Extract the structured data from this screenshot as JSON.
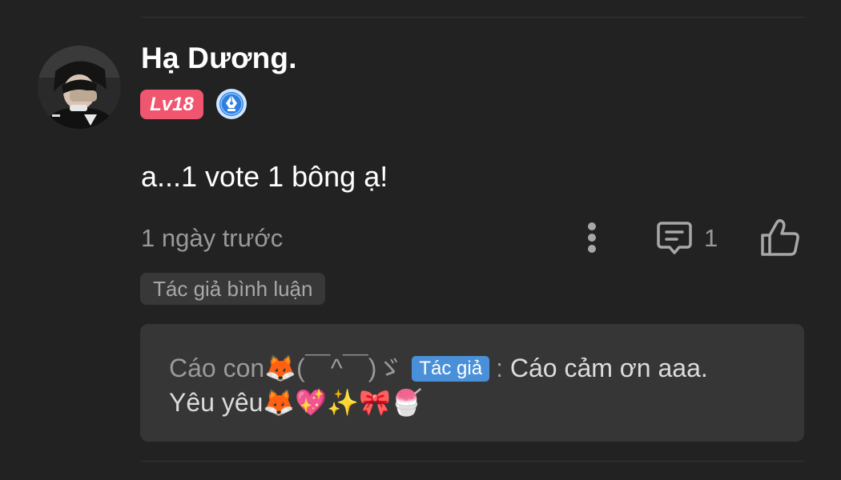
{
  "comment": {
    "username": "Hạ Dương.",
    "level_badge": "Lv18",
    "text": "a...1 vote 1 bông ạ!",
    "timestamp": "1 ngày trước",
    "reply_count": "1",
    "author_comment_tag": "Tác giả bình luận",
    "icons": {
      "avatar": "user-avatar-photo",
      "badge": "pen-nib-author-icon",
      "more": "vertical-ellipsis-icon",
      "reply": "comment-icon",
      "like": "thumbs-up-icon"
    }
  },
  "reply": {
    "author_name": "Cáo con🦊(￣^￣)ゞ",
    "author_tag": "Tác giả",
    "separator": ":",
    "text_line1": "Cáo cảm ơn aaa.",
    "text_line2": "Yêu yêu🦊💖✨🎀🍧"
  },
  "colors": {
    "background": "#222222",
    "level_badge": "#f0566f",
    "author_tag": "#4a90d9",
    "reply_box": "#363636",
    "muted_text": "#9a9a9a"
  }
}
